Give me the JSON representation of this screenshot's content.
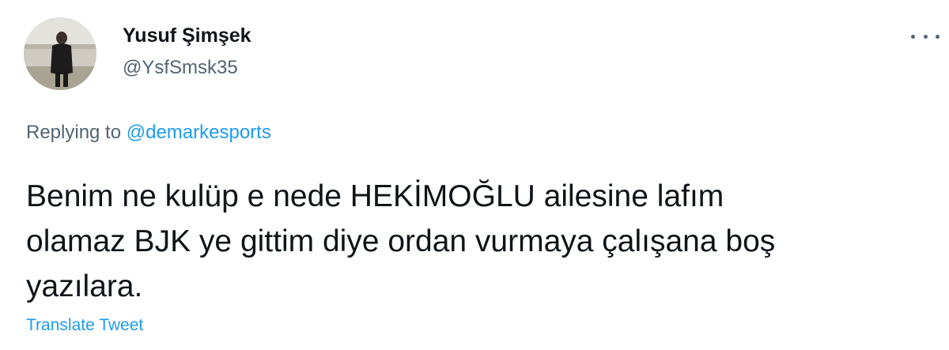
{
  "author": {
    "display_name": "Yusuf Şimşek",
    "handle": "@YsfSmsk35",
    "avatar_icon": "person-photo-avatar"
  },
  "reply": {
    "prefix": "Replying to ",
    "mention": "@demarkesports"
  },
  "tweet": {
    "text": "Benim ne kulüp e nede HEKİMOĞLU ailesine lafım\nolamaz BJK ye gittim diye ordan vurmaya çalışana boş\nyazılara."
  },
  "actions": {
    "translate_label": "Translate Tweet",
    "more_icon": "more-options-icon"
  },
  "colors": {
    "link": "#1d9bf0",
    "secondary": "#536471",
    "primary_text": "#0f1419"
  }
}
